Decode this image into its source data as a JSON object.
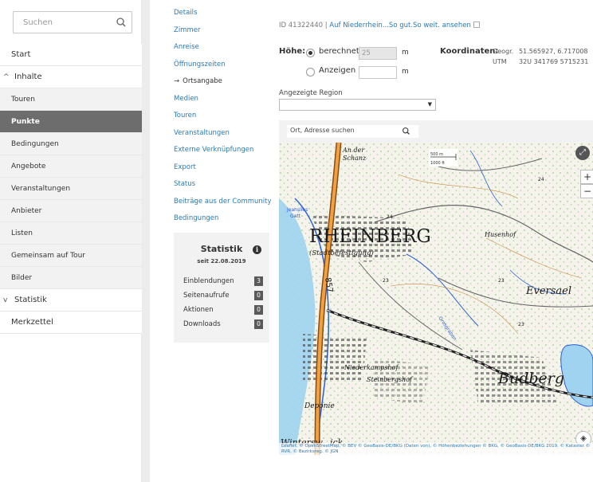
{
  "search": {
    "placeholder": "Suchen"
  },
  "nav": {
    "start": "Start",
    "inhalte": "Inhalte",
    "sub": [
      "Touren",
      "Punkte",
      "Bedingungen",
      "Angebote",
      "Veranstaltungen",
      "Anbieter",
      "Listen",
      "Gemeinsam auf Tour",
      "Bilder"
    ],
    "statistik": "Statistik",
    "merkzettel": "Merkzettel"
  },
  "subnav": {
    "items": [
      "Details",
      "Zimmer",
      "Anreise",
      "Öffnungszeiten",
      "Ortsangabe",
      "Medien",
      "Touren",
      "Veranstaltungen",
      "Externe Verknüpfungen",
      "Export",
      "Status",
      "Beiträge aus der Community",
      "Bedingungen"
    ],
    "current_marker": "→"
  },
  "stats": {
    "title": "Statistik",
    "since": "seit 22.08.2019",
    "rows": [
      {
        "label": "Einblendungen",
        "count": "3"
      },
      {
        "label": "Seitenaufrufe",
        "count": "0"
      },
      {
        "label": "Aktionen",
        "count": "0"
      },
      {
        "label": "Downloads",
        "count": "0"
      }
    ]
  },
  "main": {
    "id_prefix": "ID 41322440 |",
    "id_link": "Auf Niederrhein...So gut.So weit. ansehen",
    "hoehe_label": "Höhe:",
    "option_computed": "berechnet",
    "option_computed_value": "25",
    "option_show": "Anzeigen",
    "unit": "m",
    "koord_label": "Koordinaten:",
    "koord_geo_key": "Geogr.",
    "koord_geo_val": "51.565927, 6.717008",
    "koord_utm_key": "UTM",
    "koord_utm_val": "32U 341769 5715231",
    "region_label": "Angezeigte Region",
    "map_search_placeholder": "Ort, Adresse suchen"
  },
  "map": {
    "labels": {
      "rheinberg": "RHEINBERG",
      "stadtbef": "(Stadtbefestigung)",
      "budberg": "Budberg",
      "eversael": "Eversael",
      "deponie": "Deponie",
      "wintersw": "Wintersw",
      "wintersw_tail": "ick",
      "an_der": "An der",
      "schanz": "Schanz",
      "husenhof": "Husenhof",
      "niederkamp": "Niederkampshof",
      "steinberg": "Steinbergshof",
      "jeanliesgatt": "Jeanslies",
      "gatt": "Gatt",
      "grosgraben": "Grosgraben",
      "road_857": "857",
      "road_24a": "24",
      "road_24b": "24",
      "road_23": "23",
      "road_23b": "23",
      "road_23c": "23",
      "scale_m": "500 m",
      "scale_ft": "1000 ft"
    },
    "zoom_in": "+",
    "zoom_out": "−",
    "attribution": "Leaflet, © OpenStreetMap, © BEV © GeoBasis-DE/BKG (Daten von), © Höhenbeziehungen © BKG, © GeoBasis-DE/BKG 2019, © Kataster © RVR, © Bezirksreg. © JGN"
  },
  "colors": {
    "active_nav": "#6d6d6d",
    "link": "#2a7ab8",
    "count_badge": "#5a5a5a"
  }
}
